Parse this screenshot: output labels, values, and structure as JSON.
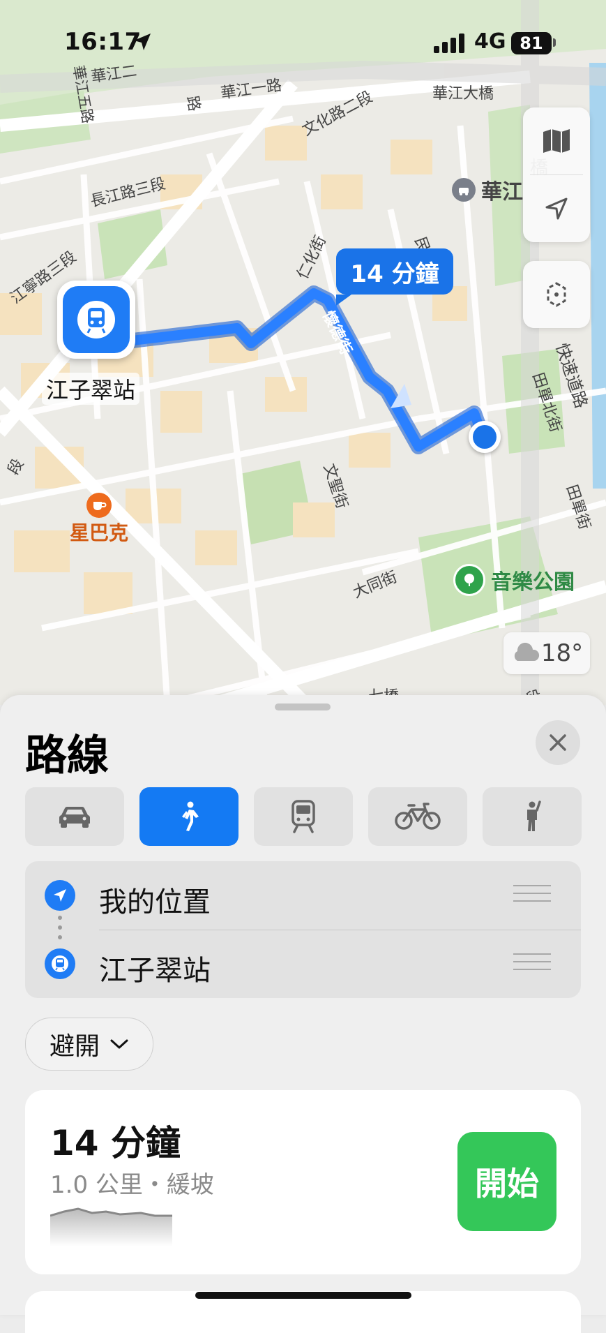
{
  "status_bar": {
    "time": "16:17",
    "network": "4G",
    "battery": "81"
  },
  "map": {
    "street_labels": [
      {
        "text": "華江五路"
      },
      {
        "text": "華江一路"
      },
      {
        "text": "華江大橋"
      },
      {
        "text": "文化路二段"
      },
      {
        "text": "長江路三段"
      },
      {
        "text": "江寧路三段"
      },
      {
        "text": "仁化街"
      },
      {
        "text": "民"
      },
      {
        "text": "文聖街"
      },
      {
        "text": "大同街"
      },
      {
        "text": "田單北街"
      },
      {
        "text": "田單街"
      },
      {
        "text": "快速道路"
      },
      {
        "text": "段"
      },
      {
        "text": "七橋"
      },
      {
        "text": "段"
      },
      {
        "text": "路"
      },
      {
        "text": "橋"
      },
      {
        "text": "華江二"
      }
    ],
    "route_street": "懷德街",
    "eta_bubble": "14 分鐘",
    "destination_label": "江子翠站",
    "poi_starbucks": "星巴克",
    "poi_park": "音樂公園",
    "poi_top_right": "華江",
    "weather": "18°",
    "colors": {
      "route": "#1a73e8",
      "starbucks": "#ee6b1d",
      "park": "#34a853"
    }
  },
  "sheet": {
    "title": "路線",
    "modes": [
      {
        "name": "car-icon",
        "active": false
      },
      {
        "name": "walk-icon",
        "active": true
      },
      {
        "name": "transit-icon",
        "active": false
      },
      {
        "name": "bike-icon",
        "active": false
      },
      {
        "name": "rideshare-icon",
        "active": false
      }
    ],
    "from": "我的位置",
    "to": "江子翠站",
    "avoid_label": "避開",
    "route": {
      "time": "14 分鐘",
      "meta": "1.0 公里・緩坡",
      "go_label": "開始"
    },
    "colors": {
      "accent": "#147af3",
      "go": "#34c759"
    }
  }
}
